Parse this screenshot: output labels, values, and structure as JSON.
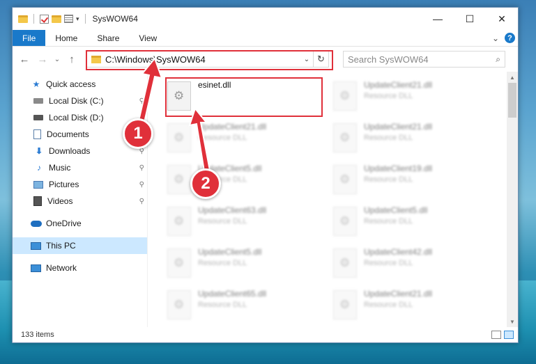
{
  "window": {
    "title": "SysWOW64",
    "minimize_glyph": "—",
    "maximize_glyph": "☐",
    "close_glyph": "✕"
  },
  "ribbon": {
    "tabs": [
      "File",
      "Home",
      "Share",
      "View"
    ],
    "collapse_glyph": "⌄",
    "help_label": "?"
  },
  "navbar": {
    "back_glyph": "←",
    "forward_glyph": "→",
    "recent_glyph": "⌄",
    "up_glyph": "↑",
    "address_path": "C:\\Windows\\SysWOW64",
    "address_chevron": "⌄",
    "refresh_glyph": "↻",
    "search_placeholder": "Search SysWOW64",
    "search_icon": "search-icon"
  },
  "sidebar": {
    "items": [
      {
        "label": "Quick access",
        "icon": "star-icon",
        "pinned": false
      },
      {
        "label": "Local Disk (C:)",
        "icon": "drive-icon",
        "pinned": true
      },
      {
        "label": "Local Disk (D:)",
        "icon": "drive-icon",
        "pinned": false
      },
      {
        "label": "Documents",
        "icon": "documents-icon",
        "pinned": true
      },
      {
        "label": "Downloads",
        "icon": "download-icon",
        "pinned": true
      },
      {
        "label": "Music",
        "icon": "music-icon",
        "pinned": true
      },
      {
        "label": "Pictures",
        "icon": "pictures-icon",
        "pinned": true
      },
      {
        "label": "Videos",
        "icon": "videos-icon",
        "pinned": true
      },
      {
        "label": "OneDrive",
        "icon": "cloud-icon",
        "pinned": false
      },
      {
        "label": "This PC",
        "icon": "computer-icon",
        "pinned": false,
        "selected": true
      },
      {
        "label": "Network",
        "icon": "network-icon",
        "pinned": false
      }
    ],
    "pin_glyph": "📌"
  },
  "files": [
    {
      "name": "esinet.dll",
      "type": ""
    },
    {
      "name": "UpdateClient21.dll",
      "type": "Resource DLL"
    },
    {
      "name": "UpdateClient21.dll",
      "type": "Resource DLL"
    },
    {
      "name": "UpdateClient21.dll",
      "type": "Resource DLL"
    },
    {
      "name": "UpdateClient5.dll",
      "type": "Resource DLL"
    },
    {
      "name": "UpdateClient19.dll",
      "type": "Resource DLL"
    },
    {
      "name": "UpdateClient63.dll",
      "type": "Resource DLL"
    },
    {
      "name": "UpdateClient5.dll",
      "type": "Resource DLL"
    },
    {
      "name": "UpdateClient5.dll",
      "type": "Resource DLL"
    },
    {
      "name": "UpdateClient42.dll",
      "type": "Resource DLL"
    },
    {
      "name": "UpdateClient65.dll",
      "type": "Resource DLL"
    },
    {
      "name": "UpdateClient21.dll",
      "type": "Resource DLL"
    }
  ],
  "status": {
    "item_count": "133 items"
  },
  "callouts": [
    {
      "number": "1"
    },
    {
      "number": "2"
    }
  ],
  "colors": {
    "accent": "#1979ca",
    "highlight": "#e0303a",
    "selection": "#cce8ff"
  }
}
